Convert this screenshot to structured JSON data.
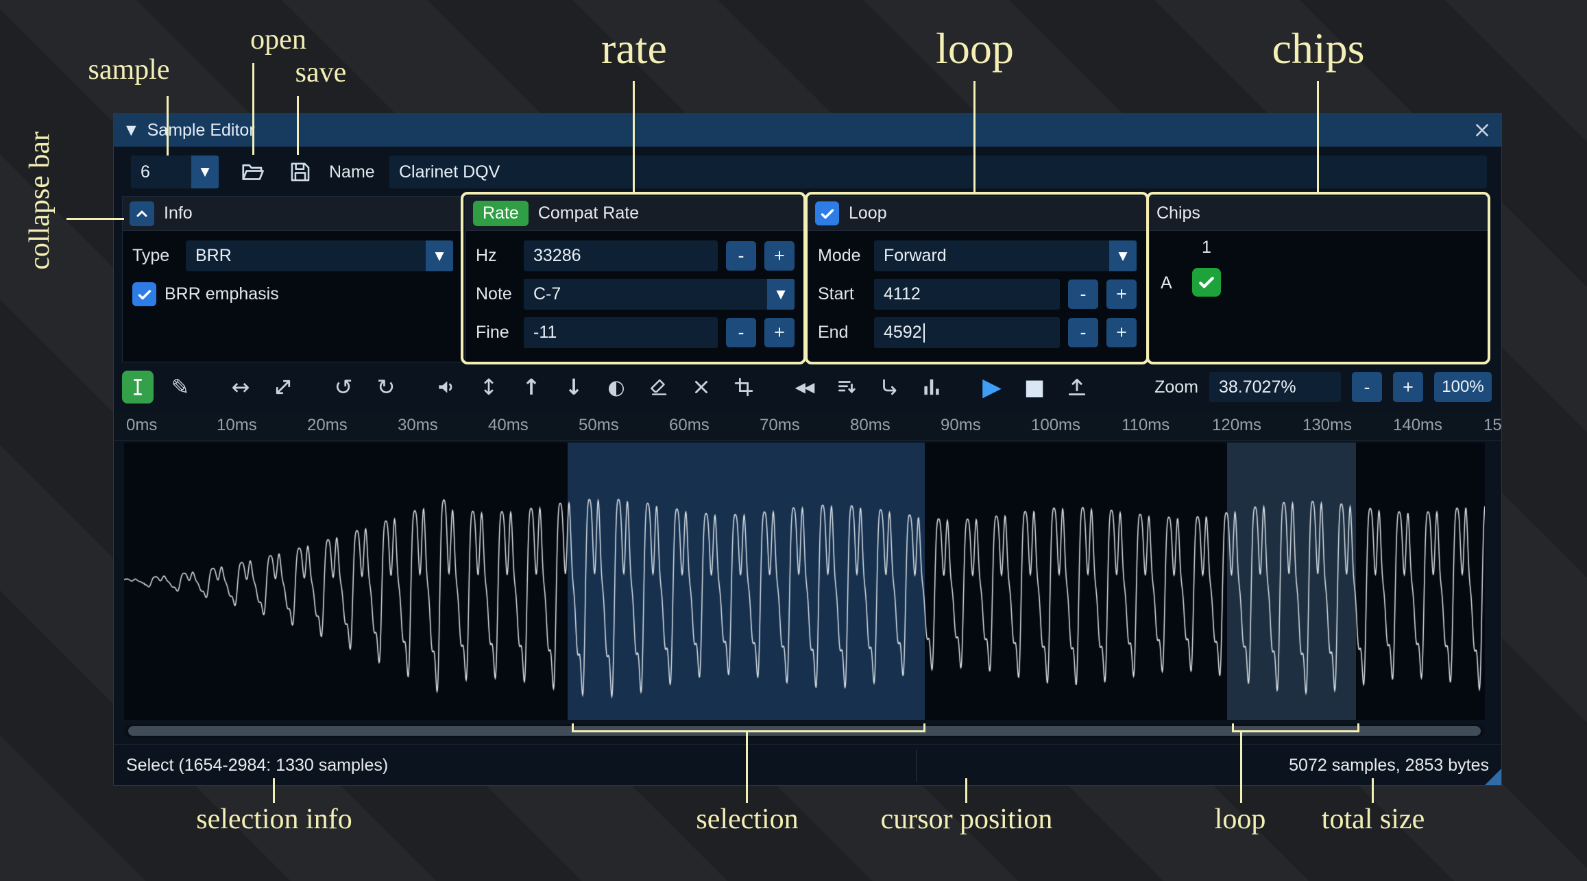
{
  "window": {
    "title": "Sample Editor"
  },
  "controls": {
    "dropdown_arrow": "▼",
    "collapse_arrow": "▼",
    "minus": "-",
    "plus": "+"
  },
  "file_row": {
    "sample_index": "6",
    "name_label": "Name",
    "name_value": "Clarinet DQV"
  },
  "info": {
    "header": "Info",
    "type_label": "Type",
    "type_value": "BRR",
    "emphasis_label": "BRR emphasis"
  },
  "rate": {
    "badge": "Rate",
    "header": "Compat Rate",
    "hz_label": "Hz",
    "hz_value": "33286",
    "note_label": "Note",
    "note_value": "C-7",
    "fine_label": "Fine",
    "fine_value": "-11"
  },
  "loop": {
    "label": "Loop",
    "mode_label": "Mode",
    "mode_value": "Forward",
    "start_label": "Start",
    "start_value": "4112",
    "end_label": "End",
    "end_value": "4592"
  },
  "chips": {
    "header": "Chips",
    "chip_column": "1",
    "chip_row": "A"
  },
  "toolbar": {
    "zoom_label": "Zoom",
    "zoom_value": "38.7027%",
    "reset_zoom": "100%",
    "icon_names": [
      "edit-select",
      "draw",
      "resize",
      "resample",
      "undo",
      "redo",
      "preview",
      "normalize",
      "fade-in",
      "fade-out",
      "invert",
      "silence",
      "delete",
      "trim",
      "reverse",
      "filter",
      "downsample",
      "spectrum",
      "play",
      "stop",
      "export"
    ],
    "glyphs": {
      "draw": "✎",
      "resize": "↔",
      "undo": "↺",
      "redo": "↻",
      "normalize": "↕",
      "fade_in": "↑",
      "fade_out": "↓",
      "invert": "◐",
      "reverse": "◀◀",
      "play": "▶",
      "stop": "■"
    }
  },
  "ruler": {
    "ticks": [
      "0ms",
      "10ms",
      "20ms",
      "30ms",
      "40ms",
      "50ms",
      "60ms",
      "70ms",
      "80ms",
      "90ms",
      "100ms",
      "110ms",
      "120ms",
      "130ms",
      "140ms",
      "150"
    ]
  },
  "waveform": {
    "total_samples": 5072,
    "selection_start": 1654,
    "selection_end": 2984,
    "loop_start": 4112,
    "loop_end": 4592
  },
  "status": {
    "selection_text": "Select (1654-2984: 1330 samples)",
    "size_text": "5072 samples, 2853 bytes"
  },
  "annotations": {
    "sample": "sample",
    "open": "open",
    "save": "save",
    "collapse_bar": "collapse bar",
    "rate": "rate",
    "loop": "loop",
    "chips": "chips",
    "selection_info": "selection info",
    "selection": "selection",
    "cursor_position": "cursor position",
    "loop_bottom": "loop",
    "total_size": "total size"
  },
  "colors": {
    "annotation": "#f4efb4",
    "accent_blue": "#1d4c7c",
    "badge_green": "#2f9e44",
    "check_blue": "#2e7de6",
    "check_green": "#1ea23a",
    "titlebar": "#173a5f"
  }
}
